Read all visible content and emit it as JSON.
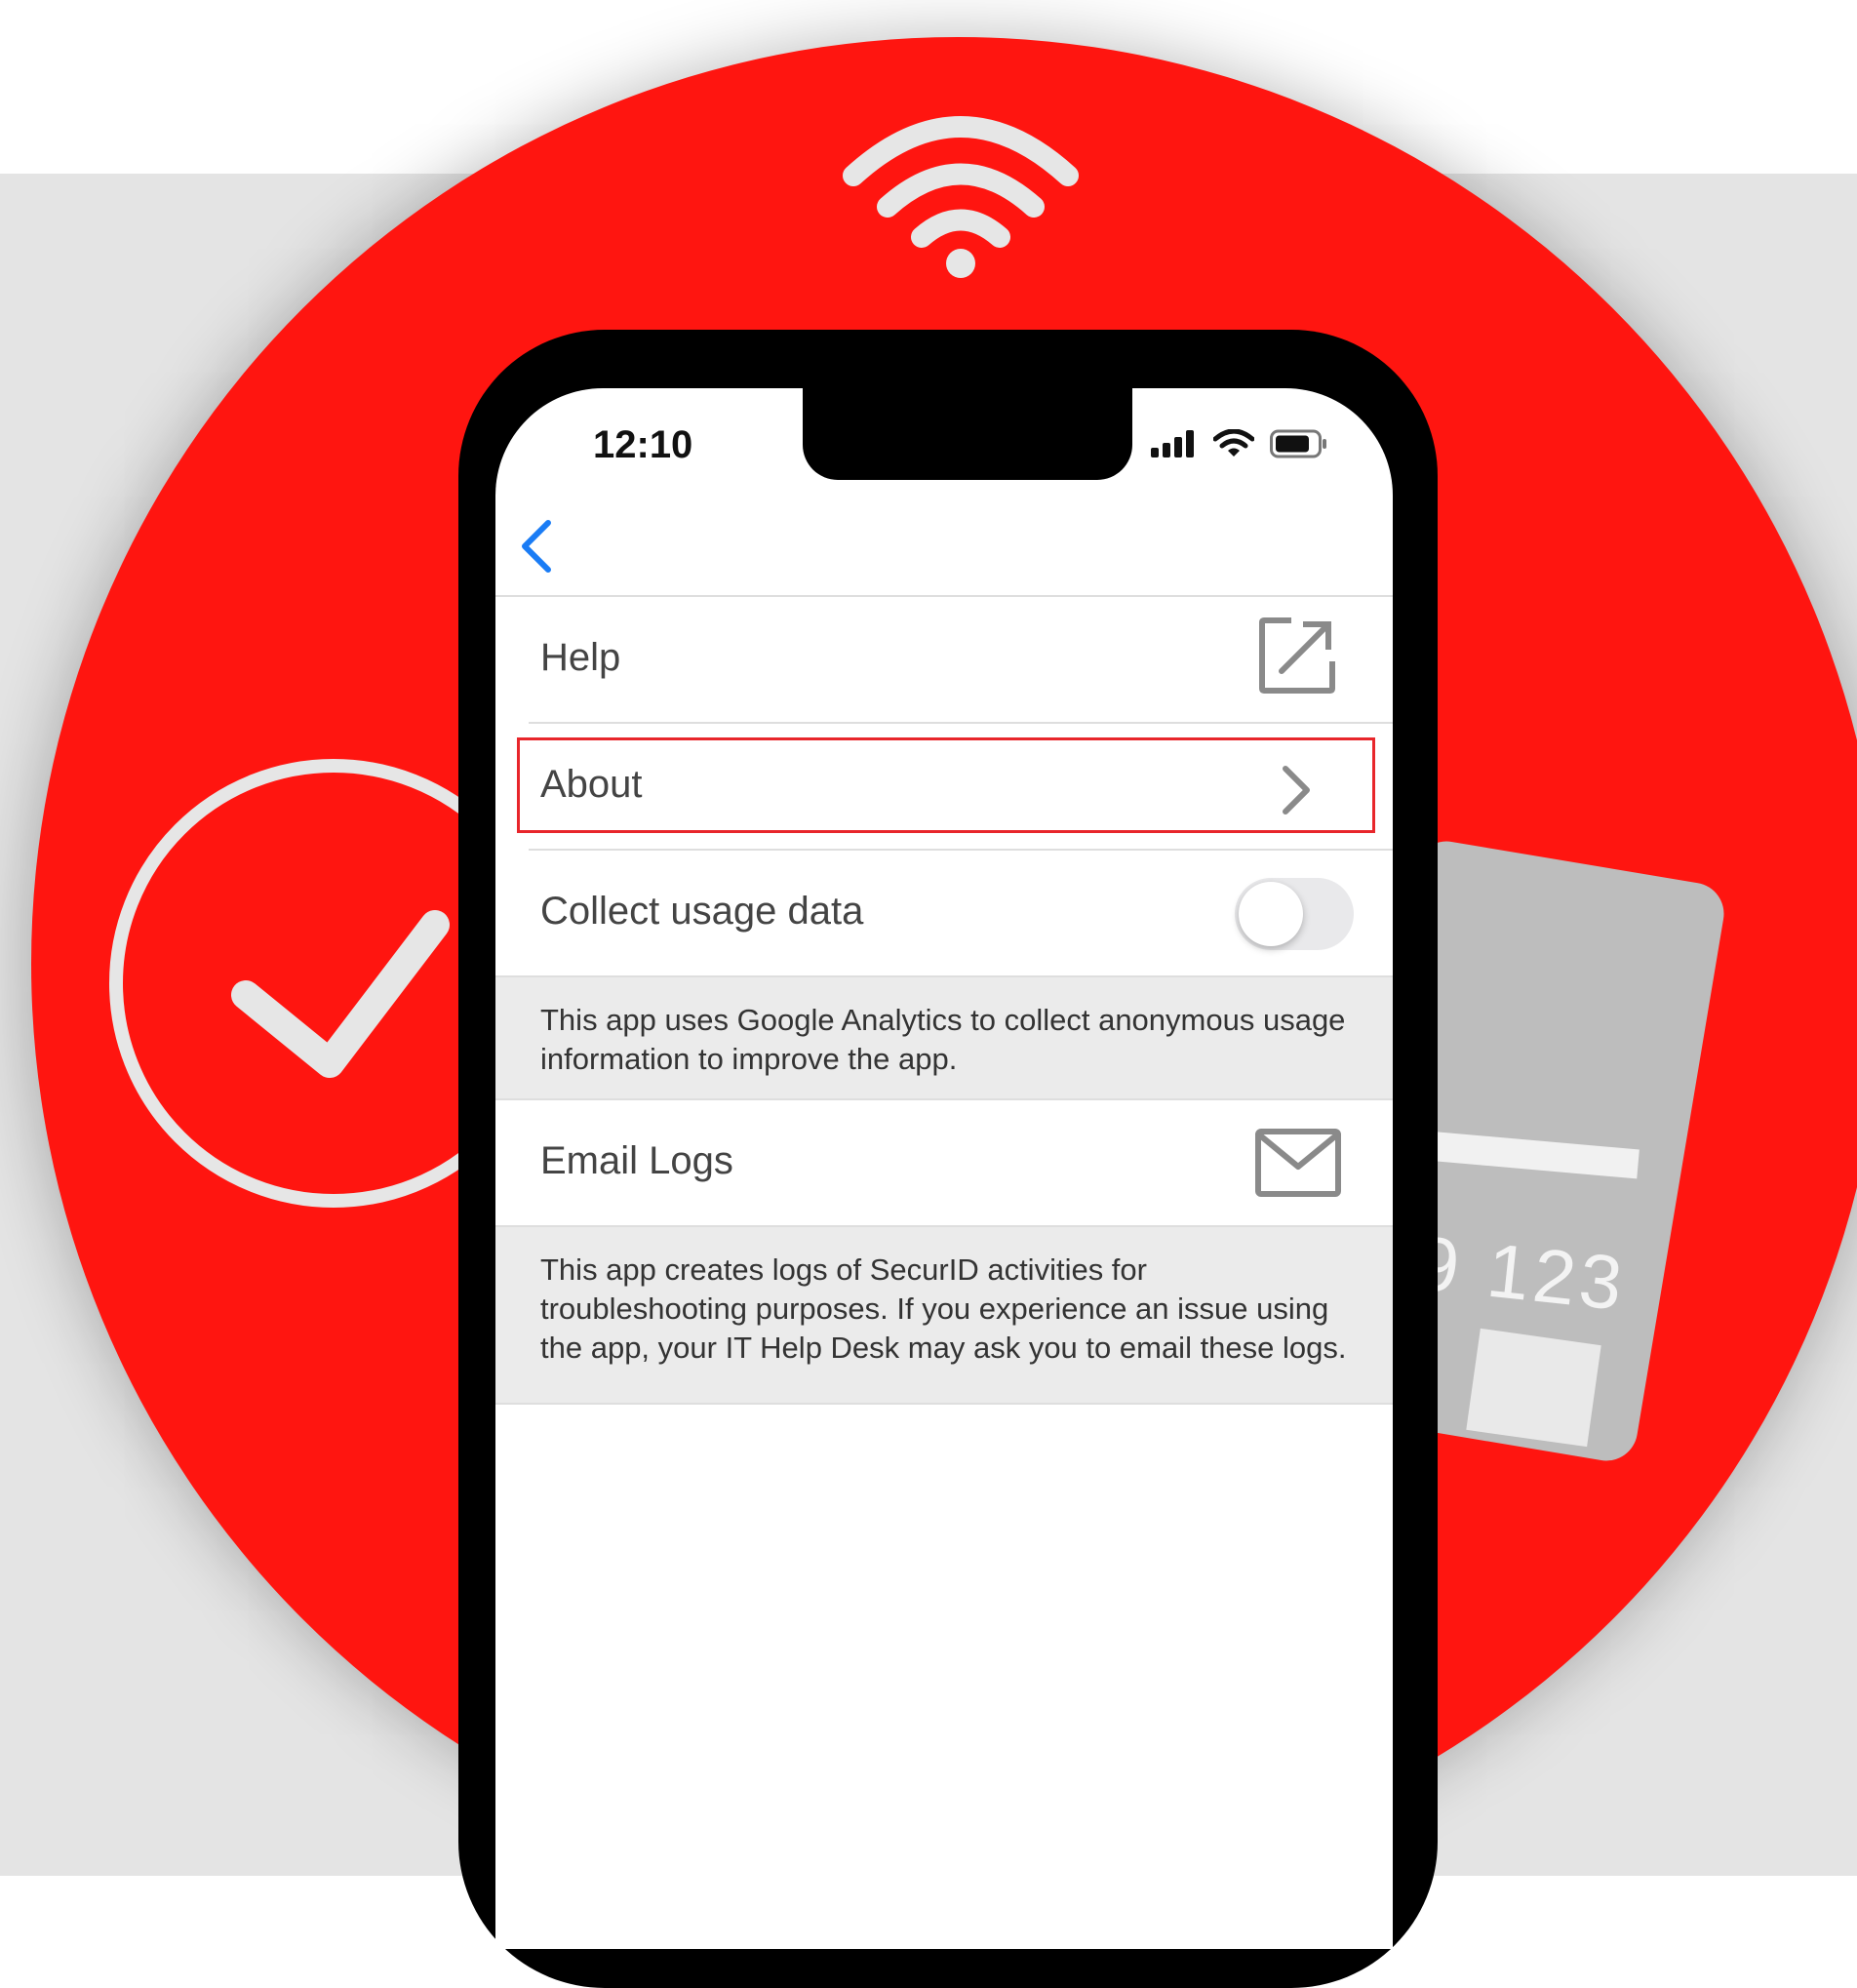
{
  "status_bar": {
    "time": "12:10"
  },
  "nav": {
    "back_icon": "chevron-left-icon",
    "accent_color": "#1a7cf5"
  },
  "settings": {
    "help": {
      "label": "Help",
      "icon": "external-link-icon"
    },
    "about": {
      "label": "About",
      "icon": "chevron-right-icon",
      "highlighted": true
    },
    "collect_usage": {
      "label": "Collect usage data",
      "enabled": false,
      "note": "This app uses Google Analytics to collect anonymous usage information to improve the app."
    },
    "email_logs": {
      "label": "Email Logs",
      "icon": "mail-icon",
      "note": "This app creates logs of SecurID activities for troubleshooting purposes. If you experience an issue using the app, your IT Help Desk may ask you to email these logs."
    }
  },
  "background": {
    "card_number_fragment": "9 123",
    "brand_color": "#ff1510",
    "decorations": [
      "wifi-icon",
      "checkmark-icon",
      "card-icon"
    ]
  }
}
